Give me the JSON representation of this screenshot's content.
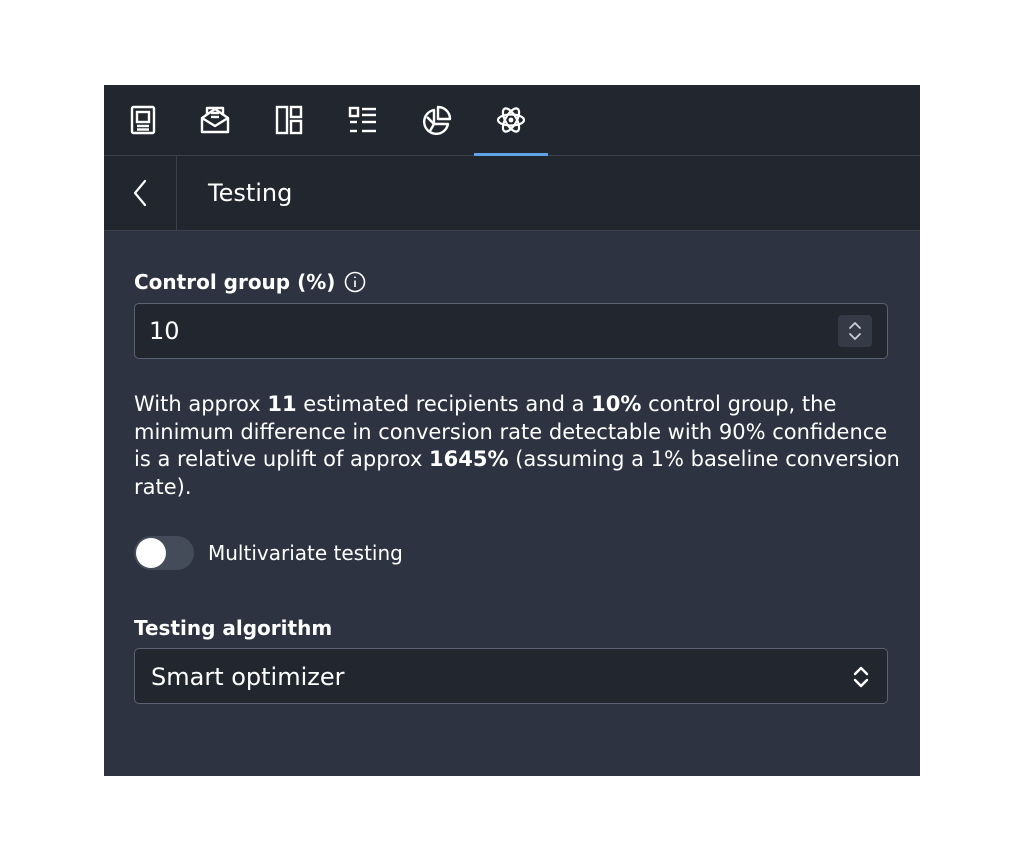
{
  "tabs": [
    {
      "icon": "document-icon"
    },
    {
      "icon": "envelope-icon"
    },
    {
      "icon": "layout-blocks-icon"
    },
    {
      "icon": "list-icon"
    },
    {
      "icon": "pie-chart-icon"
    },
    {
      "icon": "atom-icon",
      "active": true
    }
  ],
  "header": {
    "title": "Testing"
  },
  "control_group": {
    "label": "Control group (%)",
    "value": "10"
  },
  "description": {
    "p1": "With approx ",
    "recipients": "11",
    "p2": " estimated recipients and a ",
    "control_pct": "10%",
    "p3": " control group, the minimum difference in conversion rate detectable with 90% confidence is a relative uplift of approx ",
    "uplift": "1645%",
    "p4": " (assuming a 1% baseline conversion rate)."
  },
  "multivariate": {
    "label": "Multivariate testing",
    "enabled": false
  },
  "algorithm": {
    "label": "Testing algorithm",
    "value": "Smart optimizer"
  },
  "colors": {
    "accent": "#5fa2e8",
    "panel_bg": "#2d3340",
    "header_bg": "#22262e",
    "border": "#5b6271"
  }
}
